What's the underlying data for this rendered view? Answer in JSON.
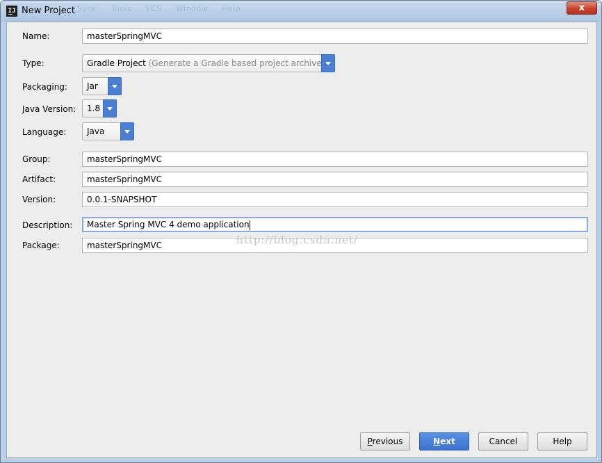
{
  "window": {
    "title": "New Project",
    "app_icon_label": "IJ",
    "ghost_menu": [
      "Sync",
      "Tools",
      "VCS",
      "Window",
      "Help"
    ],
    "close_label": "x"
  },
  "form": {
    "name": {
      "label": "Name:",
      "value": "masterSpringMVC"
    },
    "type": {
      "label": "Type:",
      "value": "Gradle Project",
      "hint": "(Generate a Gradle based project archive)"
    },
    "packaging": {
      "label": "Packaging:",
      "value": "Jar"
    },
    "java_version": {
      "label": "Java Version:",
      "value": "1.8"
    },
    "language": {
      "label": "Language:",
      "value": "Java"
    },
    "group": {
      "label": "Group:",
      "value": "masterSpringMVC"
    },
    "artifact": {
      "label": "Artifact:",
      "value": "masterSpringMVC"
    },
    "version": {
      "label": "Version:",
      "value": "0.0.1-SNAPSHOT"
    },
    "description": {
      "label": "Description:",
      "value": "Master Spring MVC 4 demo application"
    },
    "package": {
      "label": "Package:",
      "value": "masterSpringMVC"
    }
  },
  "watermark": "http://blog.csdn.net/",
  "buttons": {
    "previous_mnemonic": "P",
    "previous_rest": "revious",
    "next_mnemonic": "N",
    "next_rest": "ext",
    "cancel": "Cancel",
    "help": "Help"
  },
  "colors": {
    "accent": "#4a7fd4",
    "focus_border": "#87aadf",
    "close": "#c8412c",
    "titlebar": "#b9cfe6",
    "panel": "#ededed"
  }
}
